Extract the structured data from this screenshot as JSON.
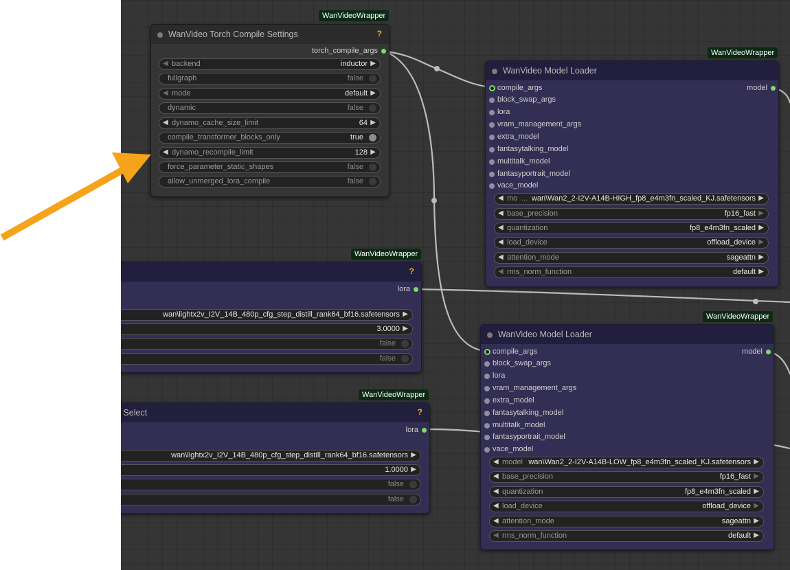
{
  "badge": "WanVideoWrapper",
  "torch": {
    "title": "WanVideo Torch Compile Settings",
    "help": "?",
    "output": "torch_compile_args",
    "widgets": [
      {
        "label": "backend",
        "value": "inductor"
      },
      {
        "label": "fullgraph",
        "value": "false"
      },
      {
        "label": "mode",
        "value": "default"
      },
      {
        "label": "dynamic",
        "value": "false"
      },
      {
        "label": "dynamo_cache_size_limit",
        "value": "64"
      },
      {
        "label": "compile_transformer_blocks_only",
        "value": "true"
      },
      {
        "label": "dynamo_recompile_limit",
        "value": "128"
      },
      {
        "label": "force_parameter_static_shapes",
        "value": "false"
      },
      {
        "label": "allow_unmerged_lora_compile",
        "value": "false"
      }
    ]
  },
  "loader1": {
    "title": "WanVideo Model Loader",
    "output": "model",
    "inputs": [
      "compile_args",
      "block_swap_args",
      "lora",
      "vram_management_args",
      "extra_model",
      "fantasytalking_model",
      "multitalk_model",
      "fantasyportrait_model",
      "vace_model"
    ],
    "widgets": [
      {
        "label": "mo",
        "value": "wan\\Wan2_2-I2V-A14B-HIGH_fp8_e4m3fn_scaled_KJ.safetensors"
      },
      {
        "label": "base_precision",
        "value": "fp16_fast"
      },
      {
        "label": "quantization",
        "value": "fp8_e4m3fn_scaled"
      },
      {
        "label": "load_device",
        "value": "offload_device"
      },
      {
        "label": "attention_mode",
        "value": "sageattn"
      },
      {
        "label": "rms_norm_function",
        "value": "default"
      }
    ]
  },
  "loader2": {
    "title": "WanVideo Model Loader",
    "output": "model",
    "inputs": [
      "compile_args",
      "block_swap_args",
      "lora",
      "vram_management_args",
      "extra_model",
      "fantasytalking_model",
      "multitalk_model",
      "fantasyportrait_model",
      "vace_model"
    ],
    "widgets": [
      {
        "label": "model",
        "value": "wan\\Wan2_2-I2V-A14B-LOW_fp8_e4m3fn_scaled_KJ.safetensors"
      },
      {
        "label": "base_precision",
        "value": "fp16_fast"
      },
      {
        "label": "quantization",
        "value": "fp8_e4m3fn_scaled"
      },
      {
        "label": "load_device",
        "value": "offload_device"
      },
      {
        "label": "attention_mode",
        "value": "sageattn"
      },
      {
        "label": "rms_norm_function",
        "value": "default"
      }
    ]
  },
  "lora1": {
    "help": "?",
    "output": "lora",
    "widgets": [
      {
        "value": "wan\\lightx2v_I2V_14B_480p_cfg_step_distill_rank64_bf16.safetensors"
      },
      {
        "value": "3.0000"
      },
      {
        "value": "false"
      },
      {
        "value": "false"
      }
    ]
  },
  "lora2": {
    "title": "a Select",
    "help": "?",
    "output": "lora",
    "widgets": [
      {
        "value": "wan\\lightx2v_I2V_14B_480p_cfg_step_distill_rank64_bf16.safetensors"
      },
      {
        "value": "1.0000"
      },
      {
        "value": "false"
      },
      {
        "value": "false"
      }
    ]
  },
  "colors": {
    "accent_arrow": "#f5a31a",
    "slot_green": "#7fdb6a",
    "help": "#f2b118"
  }
}
